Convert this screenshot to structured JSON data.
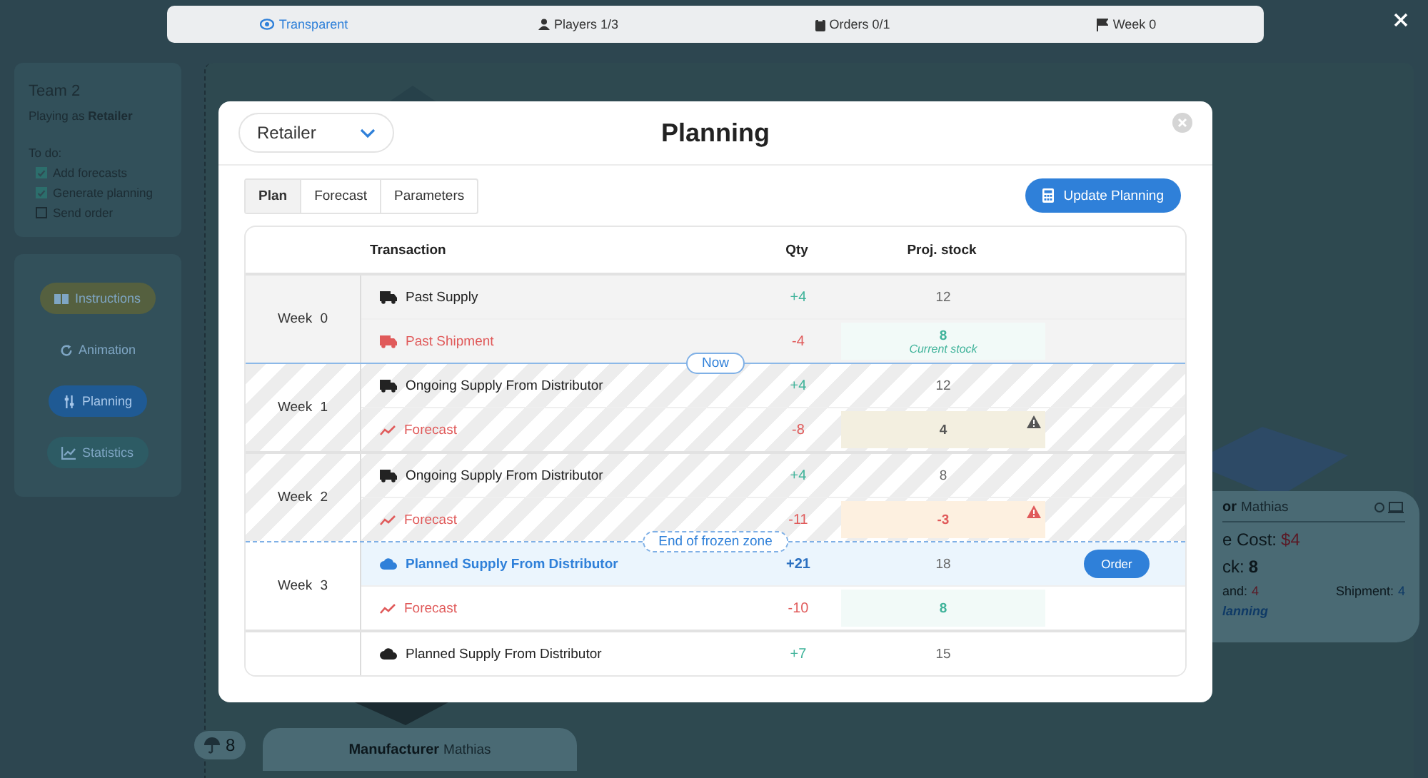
{
  "top_bar": {
    "items": [
      {
        "kind": "eye",
        "label": "Transparent",
        "selected": true
      },
      {
        "kind": "person",
        "label": "Players 1/3",
        "selected": false
      },
      {
        "kind": "clipboard",
        "label": "Orders 0/1",
        "selected": false
      },
      {
        "kind": "flag",
        "label": "Week 0",
        "selected": false
      }
    ]
  },
  "sidebar": {
    "team": "Team 2",
    "playing_as": "Playing as **Retailer**",
    "todo_title": "To do:",
    "todo": [
      {
        "label": "Add forecasts",
        "checked": true
      },
      {
        "label": "Generate planning",
        "checked": true
      },
      {
        "label": "Send order",
        "checked": false
      }
    ],
    "nav": [
      {
        "kind": "book",
        "label": "Instructions",
        "color": "#55603f",
        "selected": false
      },
      {
        "kind": "refresh",
        "label": "Animation",
        "selected": false
      },
      {
        "kind": "sliders",
        "label": "Planning",
        "color": "#1f5a94",
        "selected": true
      },
      {
        "kind": "chart",
        "label": "Statistics",
        "color": "#2d5b64",
        "selected": false
      }
    ]
  },
  "map": {
    "stock_badge": "8",
    "manufacturer": {
      "role": "Manufacturer",
      "player": "Mathias"
    },
    "node_card": {
      "role": "or",
      "player": "Mathias",
      "cost_label": "e Cost:",
      "cost": "$4",
      "stock_label": "ck:",
      "stock": "8",
      "demand_label": "and:",
      "demand": "4",
      "shipment_label": "Shipment:",
      "shipment": "4",
      "status": "lanning"
    }
  },
  "modal": {
    "role_select": {
      "value": "Retailer"
    },
    "title": "Planning",
    "tabs": [
      {
        "label": "Plan",
        "selected": true
      },
      {
        "label": "Forecast",
        "selected": false
      },
      {
        "label": "Parameters",
        "selected": false
      }
    ],
    "update_button": "Update Planning",
    "table": {
      "columns": [
        "Transaction",
        "Qty",
        "Proj. stock"
      ],
      "weeks": [
        {
          "label": "Week 0",
          "past": true,
          "frozen": false,
          "rows": [
            {
              "kind": "supply",
              "label": "Past Supply",
              "qty": "+4",
              "stock": {
                "value": "12"
              },
              "selected": false
            },
            {
              "kind": "shipment",
              "label": "Past Shipment",
              "qty": "-4",
              "stock": {
                "value": "8",
                "color": "#3fb39a",
                "note": "Current stock",
                "warning": false
              },
              "selected": false
            }
          ]
        },
        {
          "label": "Week 1",
          "past": false,
          "frozen": true,
          "marker": {
            "kind": "now",
            "label": "Now"
          },
          "rows": [
            {
              "kind": "supply",
              "label": "Ongoing Supply From Distributor",
              "qty": "+4",
              "stock": {
                "value": "12"
              },
              "selected": false
            },
            {
              "kind": "forecast",
              "label": "Forecast",
              "qty": "-8",
              "stock": {
                "value": "4",
                "color": "#555555",
                "warning": true
              },
              "selected": false
            }
          ]
        },
        {
          "label": "Week 2",
          "past": false,
          "frozen": true,
          "rows": [
            {
              "kind": "supply",
              "label": "Ongoing Supply From Distributor",
              "qty": "+4",
              "stock": {
                "value": "8"
              },
              "selected": false
            },
            {
              "kind": "forecast",
              "label": "Forecast",
              "qty": "-11",
              "stock": {
                "value": "-3",
                "color": "#e05a5a",
                "warning": true
              },
              "selected": false
            }
          ]
        },
        {
          "label": "Week 3",
          "past": false,
          "frozen": false,
          "marker": {
            "kind": "frozen_end",
            "label": "End of frozen zone"
          },
          "rows": [
            {
              "kind": "planned",
              "label": "Planned Supply From Distributor",
              "qty": "+21",
              "stock": {
                "value": "18"
              },
              "action": "Order",
              "selected": true
            },
            {
              "kind": "forecast",
              "label": "Forecast",
              "qty": "-10",
              "stock": {
                "value": "8",
                "color": "#3fb39a",
                "warning": false
              },
              "selected": false
            }
          ]
        },
        {
          "past": false,
          "frozen": false,
          "rows": [
            {
              "kind": "planned",
              "label": "Planned Supply From Distributor",
              "qty": "+7",
              "stock": {
                "value": "15"
              },
              "selected": false
            }
          ]
        }
      ]
    }
  }
}
